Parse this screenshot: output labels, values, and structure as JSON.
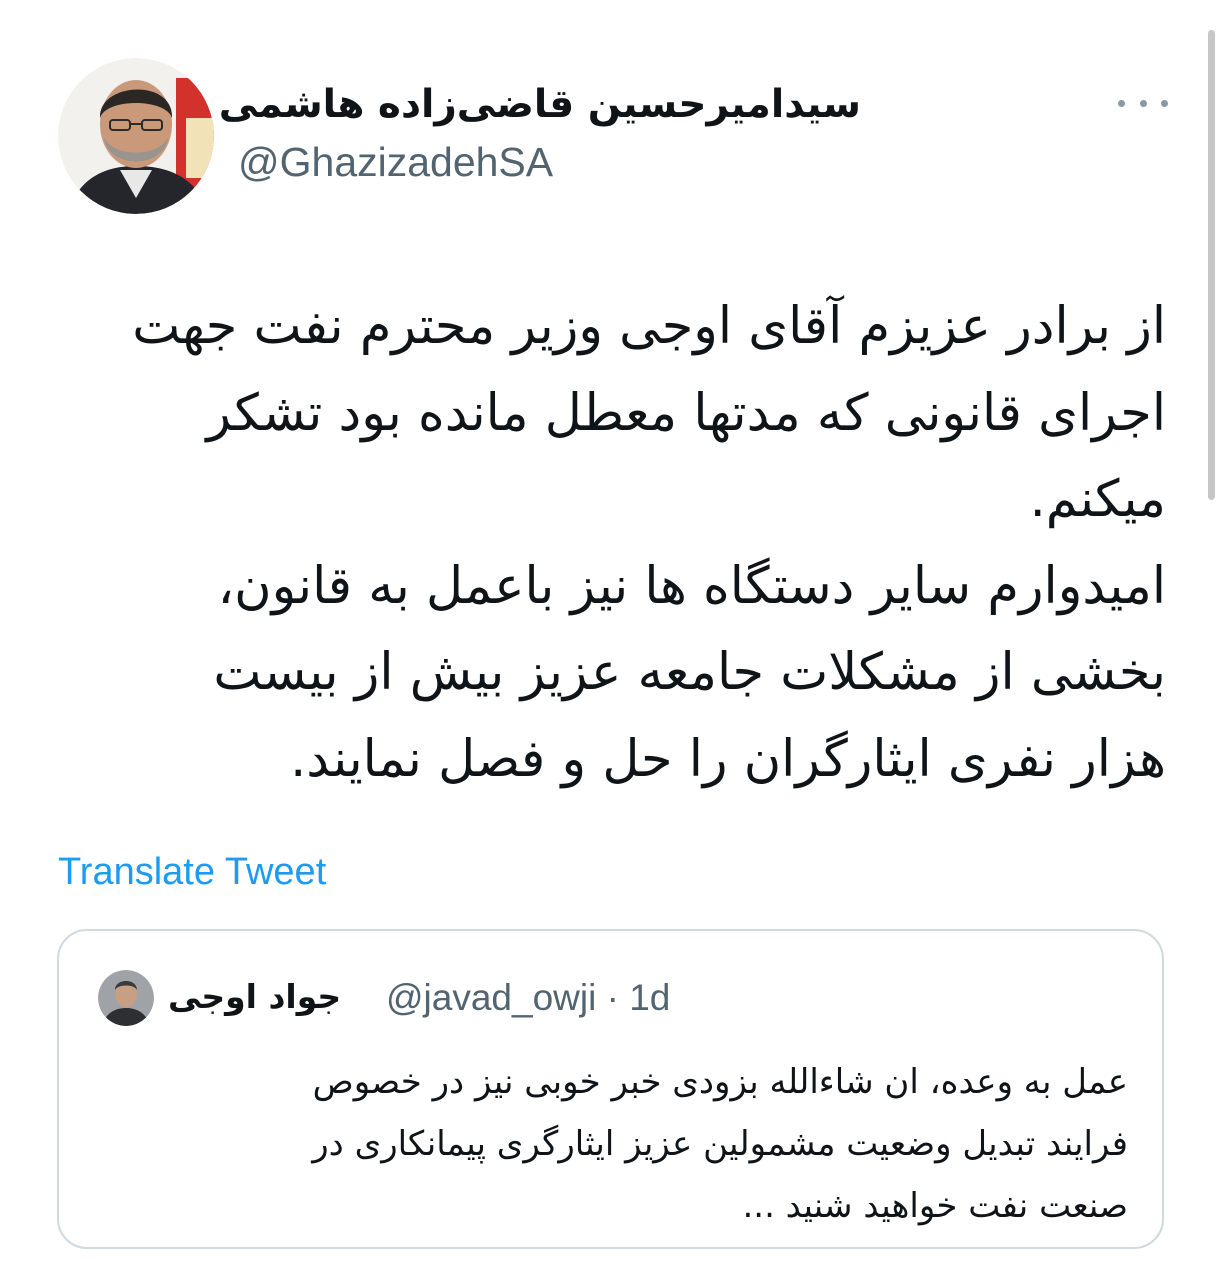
{
  "tweet": {
    "author": {
      "display_name": "سیدامیرحسین قاضی‌زاده هاشمی",
      "handle": "@GhazizadehSA"
    },
    "text_lines": [
      "از برادر عزیزم آقای اوجی وزیر محترم نفت جهت",
      "اجرای قانونی که مدتها معطل مانده بود تشکر",
      "میکنم.",
      "امیدوارم سایر دستگاه ها نیز باعمل به قانون،",
      "بخشی از مشکلات جامعه عزیز بیش از بیست",
      "هزار نفری ایثارگران را حل و فصل نمایند."
    ],
    "translate_label": "Translate Tweet",
    "more_icon": "more-icon"
  },
  "quoted_tweet": {
    "author": {
      "display_name": "جواد اوجی",
      "handle": "@javad_owji",
      "separator": "·",
      "time": "1d"
    },
    "text_lines": [
      "عمل به وعده، ان شاءالله بزودی خبر خوبی نیز در خصوص",
      "فرایند تبدیل وضعیت مشمولین عزیز ایثارگری پیمانکاری در",
      "صنعت نفت خواهید شنید ..."
    ]
  },
  "colors": {
    "text_primary": "#0f1419",
    "text_secondary": "#536471",
    "link": "#1d9bf0",
    "border": "#cfd9de"
  }
}
